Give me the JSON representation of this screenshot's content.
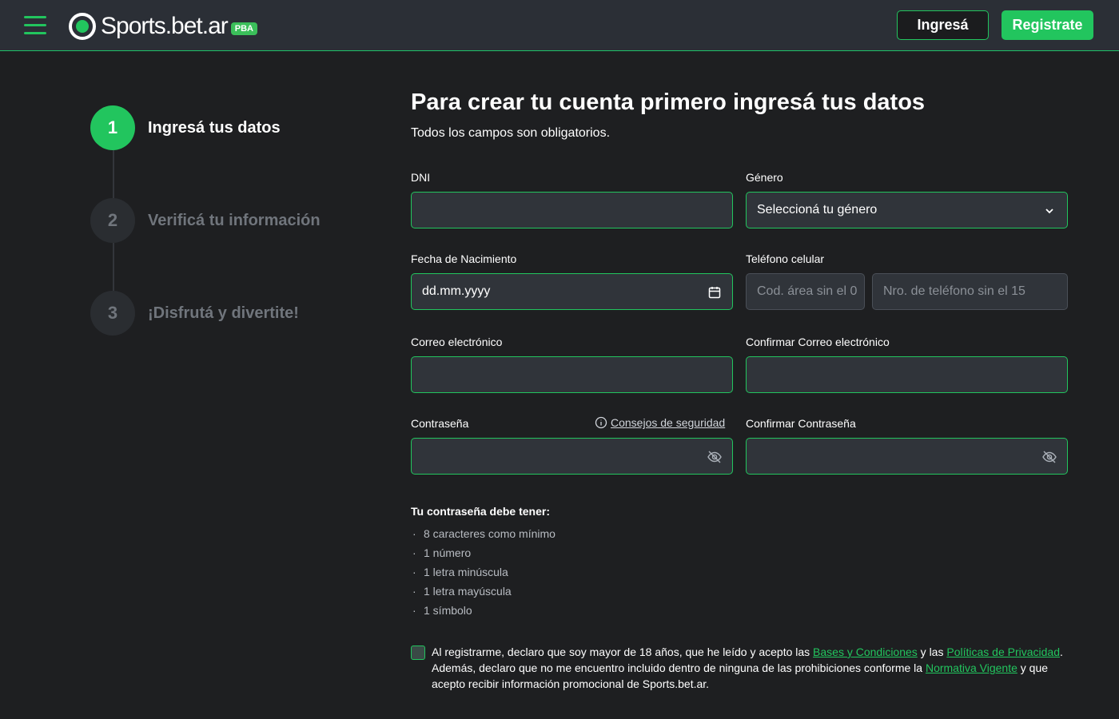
{
  "header": {
    "logo_text": "Sports.bet.ar",
    "logo_badge": "PBA",
    "login_label": "Ingresá",
    "register_label": "Registrate"
  },
  "steps": [
    {
      "number": "1",
      "label": "Ingresá tus datos",
      "state": "active"
    },
    {
      "number": "2",
      "label": "Verificá tu información",
      "state": "inactive"
    },
    {
      "number": "3",
      "label": "¡Disfrutá y divertite!",
      "state": "inactive"
    }
  ],
  "form": {
    "title": "Para crear tu cuenta primero ingresá tus datos",
    "subtitle": "Todos los campos son obligatorios.",
    "dni": {
      "label": "DNI",
      "value": ""
    },
    "genero": {
      "label": "Género",
      "value": "Seleccioná tu género"
    },
    "fecha": {
      "label": "Fecha de Nacimiento",
      "value": "dd.mm.yyyy"
    },
    "telefono": {
      "label": "Teléfono celular",
      "area_placeholder": "Cod. área sin el 0",
      "number_placeholder": "Nro. de teléfono sin el 15"
    },
    "correo": {
      "label": "Correo electrónico",
      "value": ""
    },
    "confirmar_correo": {
      "label": "Confirmar Correo electrónico",
      "value": ""
    },
    "contrasena": {
      "label": "Contraseña",
      "value": ""
    },
    "security_tips": "Consejos de seguridad",
    "confirmar_contrasena": {
      "label": "Confirmar Contraseña",
      "value": ""
    }
  },
  "password_requirements": {
    "title": "Tu contraseña debe tener:",
    "items": [
      "8 caracteres como mínimo",
      "1 número",
      "1 letra minúscula",
      "1 letra mayúscula",
      "1 símbolo"
    ]
  },
  "terms": {
    "part1": "Al registrarme, declaro que soy mayor de 18 años, que he leído y acepto las ",
    "link1": "Bases y Condiciones",
    "part2": " y las ",
    "link2": "Políticas de Privacidad",
    "part3": ". Además, declaro que no me encuentro incluido dentro de ninguna de las prohibiciones conforme la ",
    "link3": "Normativa Vigente",
    "part4": " y que acepto recibir información promocional de Sports.bet.ar."
  },
  "colors": {
    "accent": "#22c55e",
    "background": "#1e1f21",
    "header": "#2b2f36",
    "field": "#30343a"
  },
  "icons": [
    "menu-icon",
    "logo-icon",
    "chevron-down-icon",
    "calendar-icon",
    "info-icon",
    "eye-off-icon"
  ]
}
